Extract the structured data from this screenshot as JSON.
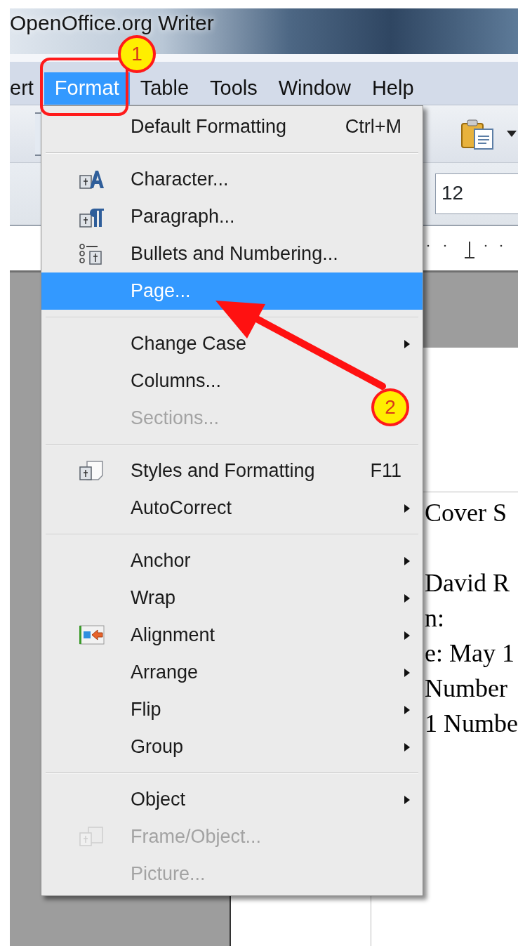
{
  "window": {
    "title": "OpenOffice.org Writer"
  },
  "menubar": [
    {
      "label": "ert",
      "selected": false
    },
    {
      "label": "Format",
      "selected": true
    },
    {
      "label": "Table",
      "selected": false
    },
    {
      "label": "Tools",
      "selected": false
    },
    {
      "label": "Window",
      "selected": false
    },
    {
      "label": "Help",
      "selected": false
    }
  ],
  "formatting_bar": {
    "font_size": "12"
  },
  "format_menu": [
    {
      "kind": "item",
      "label": "Default Formatting",
      "shortcut": "Ctrl+M",
      "submenu": false,
      "disabled": false,
      "selected": false
    },
    {
      "kind": "separator"
    },
    {
      "kind": "item",
      "label": "Character...",
      "submenu": false,
      "disabled": false,
      "selected": false
    },
    {
      "kind": "item",
      "label": "Paragraph...",
      "submenu": false,
      "disabled": false,
      "selected": false
    },
    {
      "kind": "item",
      "label": "Bullets and Numbering...",
      "submenu": false,
      "disabled": false,
      "selected": false
    },
    {
      "kind": "item",
      "label": "Page...",
      "submenu": false,
      "disabled": false,
      "selected": true
    },
    {
      "kind": "separator"
    },
    {
      "kind": "item",
      "label": "Change Case",
      "submenu": true,
      "disabled": false,
      "selected": false
    },
    {
      "kind": "item",
      "label": "Columns...",
      "submenu": false,
      "disabled": false,
      "selected": false
    },
    {
      "kind": "item",
      "label": "Sections...",
      "submenu": false,
      "disabled": true,
      "selected": false
    },
    {
      "kind": "separator"
    },
    {
      "kind": "item",
      "label": "Styles and Formatting",
      "shortcut": "F11",
      "submenu": false,
      "disabled": false,
      "selected": false
    },
    {
      "kind": "item",
      "label": "AutoCorrect",
      "submenu": true,
      "disabled": false,
      "selected": false
    },
    {
      "kind": "separator"
    },
    {
      "kind": "item",
      "label": "Anchor",
      "submenu": true,
      "disabled": false,
      "selected": false
    },
    {
      "kind": "item",
      "label": "Wrap",
      "submenu": true,
      "disabled": false,
      "selected": false
    },
    {
      "kind": "item",
      "label": "Alignment",
      "submenu": true,
      "disabled": false,
      "selected": false
    },
    {
      "kind": "item",
      "label": "Arrange",
      "submenu": true,
      "disabled": false,
      "selected": false
    },
    {
      "kind": "item",
      "label": "Flip",
      "submenu": true,
      "disabled": false,
      "selected": false
    },
    {
      "kind": "item",
      "label": "Group",
      "submenu": true,
      "disabled": false,
      "selected": false
    },
    {
      "kind": "separator"
    },
    {
      "kind": "item",
      "label": "Object",
      "submenu": true,
      "disabled": false,
      "selected": false
    },
    {
      "kind": "item",
      "label": "Frame/Object...",
      "submenu": false,
      "disabled": true,
      "selected": false
    },
    {
      "kind": "item",
      "label": "Picture...",
      "submenu": false,
      "disabled": true,
      "selected": false
    }
  ],
  "document": {
    "paragraphs": [
      [
        "Cover S"
      ],
      [
        "David R",
        "n:",
        "e: May 1",
        "Number",
        "1 Numbe"
      ]
    ]
  },
  "annotations": [
    {
      "label": "1"
    },
    {
      "label": "2"
    }
  ]
}
